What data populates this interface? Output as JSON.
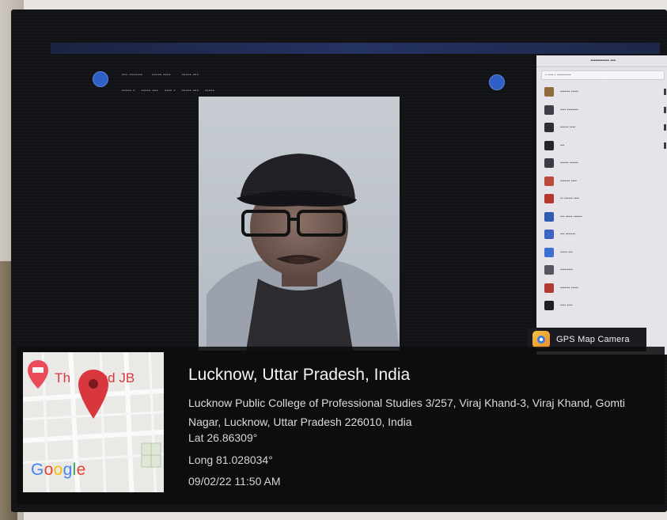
{
  "location": {
    "title": "Lucknow, Uttar Pradesh, India",
    "address": "Lucknow Public College of Professional Studies 3/257, Viraj Khand-3, Viraj Khand, Gomti Nagar, Lucknow, Uttar Pradesh 226010, India",
    "lat": "Lat 26.86309°",
    "long": "Long 81.028034°",
    "datetime": "09/02/22 11:50 AM"
  },
  "map": {
    "place_label_a": "Th",
    "place_label_b": "and JB",
    "brand": [
      "G",
      "o",
      "o",
      "g",
      "l",
      "e"
    ]
  },
  "gps_app": {
    "name": "GPS Map Camera"
  },
  "colors": {
    "pin": "#d8373d",
    "toolbar_button": "#2e5fc7",
    "gps_logo": "#f5c243"
  },
  "icons": [
    "map-pin-icon",
    "hotel-marker-icon",
    "camera-app-icon",
    "toolbar-back-icon",
    "toolbar-forward-icon"
  ]
}
